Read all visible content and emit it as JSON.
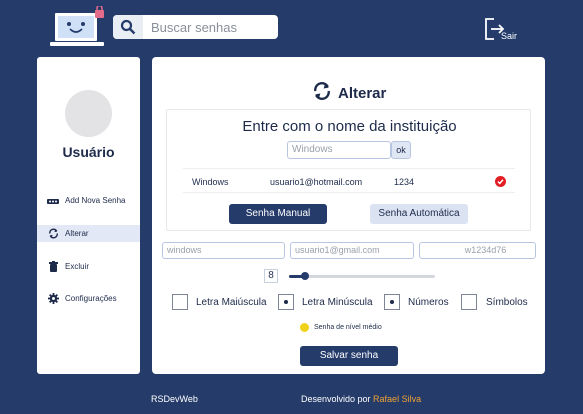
{
  "header": {
    "search_placeholder": "Buscar senhas",
    "logout_label": "Sair"
  },
  "sidebar": {
    "user_name": "Usuário",
    "items": [
      {
        "label": "Add Nova Senha",
        "icon": "add-password-icon"
      },
      {
        "label": "Alterar",
        "icon": "change-icon",
        "active": true
      },
      {
        "label": "Excluir",
        "icon": "trash-icon"
      },
      {
        "label": "Configurações",
        "icon": "gear-icon"
      }
    ]
  },
  "main": {
    "title": "Alterar",
    "panel": {
      "title": "Entre com o nome da instituição",
      "institution_placeholder": "Windows",
      "ok_label": "ok",
      "result": {
        "institution": "Windows",
        "email": "usuario1@hotmail.com",
        "password": "1234"
      },
      "manual_label": "Senha Manual",
      "auto_label": "Senha Automática"
    },
    "fields": {
      "institution_value": "windows",
      "email_value": "usuario1@gmail.com",
      "password_value": "w1234d76"
    },
    "length": "8",
    "length_fraction": 0.1,
    "options": [
      {
        "label": "Letra Maiúscula",
        "checked": false
      },
      {
        "label": "Letra Minúscula",
        "checked": true
      },
      {
        "label": "Números",
        "checked": true
      },
      {
        "label": "Símbolos",
        "checked": false
      }
    ],
    "strength_label": "Senha de nível médio",
    "save_label": "Salvar senha"
  },
  "footer": {
    "brand": "RSDevWeb",
    "credit": "Desenvolvido por ",
    "author": "Rafael Silva"
  },
  "colors": {
    "primary": "#253c6b",
    "accent": "#f0a134",
    "warning": "#f0d21a",
    "danger": "#e21d24"
  }
}
